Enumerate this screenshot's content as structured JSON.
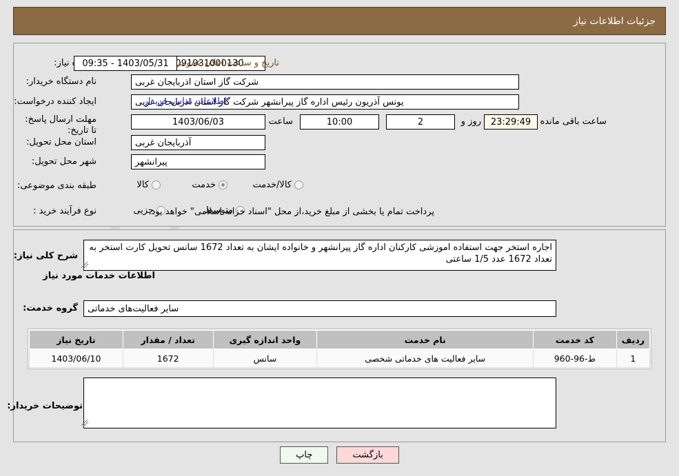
{
  "header": {
    "title": "جزئیات اطلاعات نیاز"
  },
  "form": {
    "need_number_label": "شماره نیاز:",
    "need_number_value": "1103091931000130",
    "announce_datetime_label": "تاریخ و ساعت اعلان عمومی:",
    "announce_datetime_value": "1403/05/31 - 09:35",
    "buyer_org_label": "نام دستگاه خریدار:",
    "buyer_org_value": "شرکت گاز استان اذربایجان غربی",
    "creator_label": "ایجاد کننده درخواست:",
    "creator_value": "یونس آذریون رئیس اداره گاز پیرانشهر شرکت گاز استان اذربایجان غربی",
    "contact_link": "اطلاعات تماس خریدار",
    "deadline_label": "مهلت ارسال پاسخ: تا تاریخ:",
    "deadline_date": "1403/06/03",
    "deadline_hour_label": "ساعت",
    "deadline_hour_value": "10:00",
    "remaining_days": "2",
    "days_and_label": "روز و",
    "remaining_time": "23:29:49",
    "remaining_suffix": "ساعت باقی مانده",
    "province_label": "استان محل تحویل:",
    "province_value": "آذربایجان غربی",
    "city_label": "شهر محل تحویل:",
    "city_value": "پیرانشهر",
    "category_label": "طبقه بندی موضوعی:",
    "category_options": [
      {
        "label": "کالا",
        "selected": false
      },
      {
        "label": "خدمت",
        "selected": true
      },
      {
        "label": "کالا/خدمت",
        "selected": false
      }
    ],
    "process_label": "نوع فرآیند خرید :",
    "process_options": [
      {
        "label": "جزیی",
        "selected": false
      },
      {
        "label": "متوسط",
        "selected": false
      }
    ],
    "payment_note": "پرداخت تمام یا بخشی از مبلغ خرید،از محل \"اسناد خزانه اسلامی\" خواهد بود."
  },
  "description": {
    "label": "شرح کلی نیاز:",
    "value": "اجاره استخر جهت استفاده اموزشی کارکنان اداره گاز پیرانشهر و خانواده ایشان به تعداد 1672 سانس تحویل کارت استخر به تعداد 1672 عدد 1/5 ساعتی"
  },
  "services": {
    "section_title": "اطلاعات خدمات مورد نیاز",
    "group_label": "گروه خدمت:",
    "group_value": "سایر فعالیت‌های خدماتی",
    "table": {
      "columns": [
        "ردیف",
        "کد خدمت",
        "نام خدمت",
        "واحد اندازه گیری",
        "تعداد / مقدار",
        "تاریخ نیاز"
      ],
      "rows": [
        [
          "1",
          "ط-96-960",
          "سایر فعالیت های خدماتی شخصی",
          "سانس",
          "1672",
          "1403/06/10"
        ]
      ]
    }
  },
  "buyer_notes": {
    "label": "توضیحات خریدار:",
    "value": ""
  },
  "buttons": {
    "print": "چاپ",
    "back": "بازگشت"
  },
  "watermark": {
    "text": "AriaTender.net"
  },
  "colors": {
    "header_bg": "#8c6a44",
    "link": "#2222cc",
    "timer_bg": "#fbfbe8",
    "print_btn_bg": "#eefaee",
    "back_btn_bg": "#fbd9d9"
  }
}
